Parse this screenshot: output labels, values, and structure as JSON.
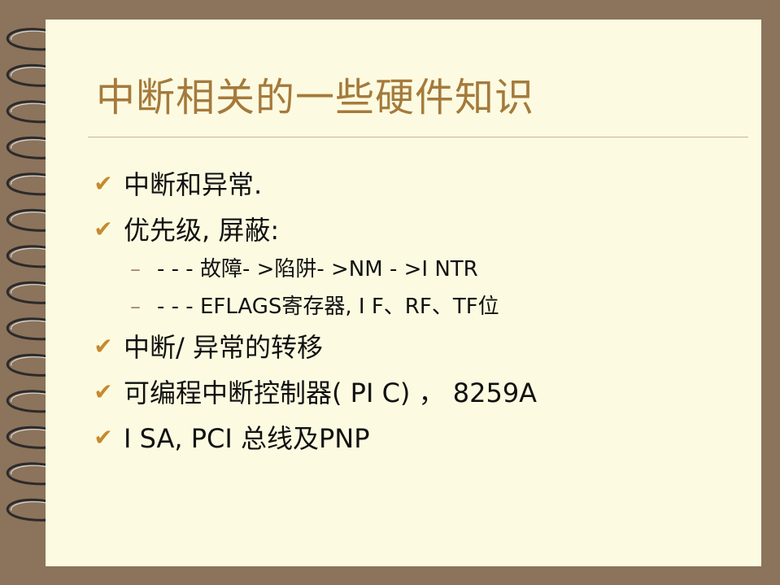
{
  "title": "中断相关的一些硬件知识",
  "colors": {
    "background": "#8c735b",
    "page": "#fcfbe1",
    "title": "#a57a3c",
    "bullet_mark": "#c68a2f",
    "rule": "#c9b49a"
  },
  "icons": {
    "bullet": "check-mark-icon",
    "binding": "spiral-ring-icon"
  },
  "bullets": [
    {
      "text": "中断和异常."
    },
    {
      "text": "优先级, 屏蔽:"
    },
    {
      "text": "中断/ 异常的转移"
    },
    {
      "text": "可编程中断控制器( PI C) ， 8259A"
    },
    {
      "text": "I SA, PCI 总线及PNP"
    }
  ],
  "sub_items": [
    {
      "dash": "–",
      "text": "- - - 故障- >陷阱- >NM - >I NTR"
    },
    {
      "dash": "–",
      "text": "- - -   EFLAGS寄存器, I F、RF、TF位"
    }
  ]
}
